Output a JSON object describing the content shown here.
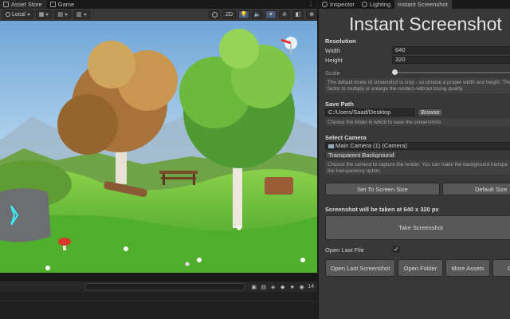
{
  "editor": {
    "left_tabs": [
      {
        "label": "Asset Store"
      },
      {
        "label": "Game"
      }
    ],
    "toolbar": {
      "pivot_label": "Local",
      "mode_2d_label": "2D"
    },
    "bottom": {
      "count_label": "14"
    }
  },
  "panel": {
    "tabs": [
      {
        "label": "Inspector"
      },
      {
        "label": "Lighting"
      },
      {
        "label": "Instant Screenshot"
      }
    ],
    "title": "Instant Screenshot",
    "resolution": {
      "header": "Resolution",
      "width_label": "Width",
      "width_value": "640",
      "height_label": "Height",
      "height_value": "320",
      "scale_label": "Scale",
      "help_line1": "The default mode of screenshot is crop - so choose a proper width and height. The",
      "help_line2": "factor to multiply or enlarge the renders without losing quality."
    },
    "save_path": {
      "header": "Save Path",
      "value": "C:/Users/Saad/Desktop",
      "browse_label": "Browse",
      "help": "Choose the folder in which to save the screenshots"
    },
    "camera": {
      "header": "Select Camera",
      "value": "Main Camera (1) (Camera)",
      "transparent_label": "Transparent Background",
      "help_line1": "Choose the camera to capture the render. You can make the background transpa",
      "help_line2": "the transparency option."
    },
    "buttons": {
      "set_to_screen_size": "Set To Screen Size",
      "default_size": "Default Size",
      "take_screenshot": "Take Screenshot",
      "open_last_screenshot": "Open Last Screenshot",
      "open_folder": "Open Folder",
      "more_assets": "More Assets",
      "extra": "G"
    },
    "info_text": "Screenshot will be taken at 640 x 320 px",
    "open_last_file_label": "Open Last File",
    "open_last_file_checked": "✓"
  },
  "colors": {
    "panel_bg": "#383838",
    "button_bg": "#585858",
    "field_bg": "#2a2a2a",
    "sky": "#7fb0da",
    "grass": "#5fc13a",
    "autumn_tree": "#b07a3a",
    "green_tree": "#5aa83a"
  },
  "icons": [
    "unity-asset-store-icon",
    "game-view-icon",
    "dots-menu-icon",
    "camera-icon",
    "checkmark-icon"
  ]
}
